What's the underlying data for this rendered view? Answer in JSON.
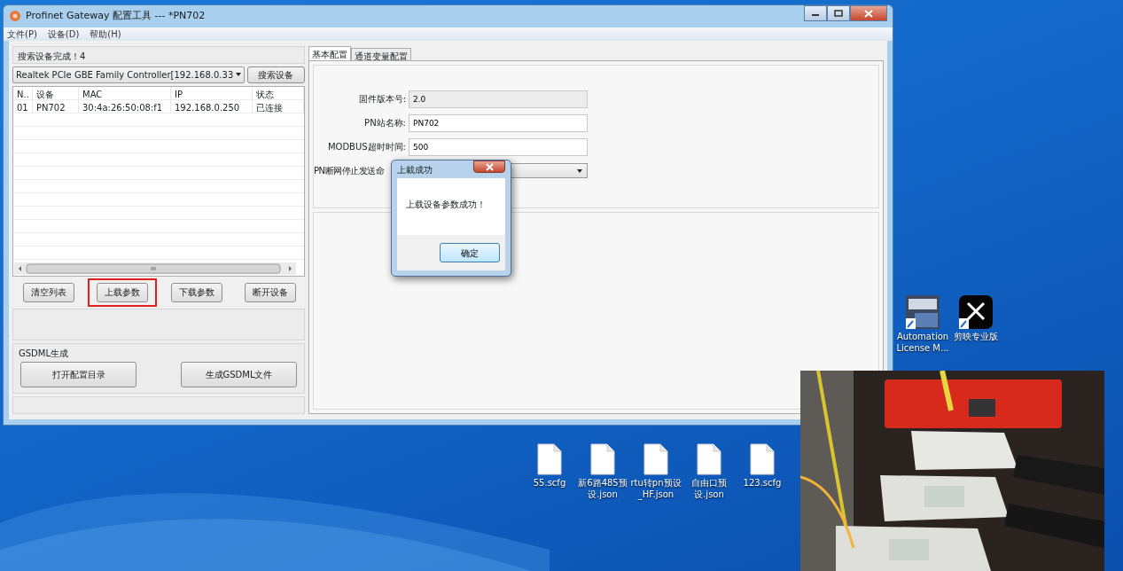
{
  "window": {
    "title": "Profinet Gateway 配置工具 --- *PN702",
    "menu": [
      "文件(P)",
      "设备(D)",
      "帮助(H)"
    ]
  },
  "device_panel": {
    "status": "搜索设备完成！4",
    "adapter": "Realtek PCIe GBE Family Controller[192.168.0.33",
    "search_button": "搜索设备",
    "table": {
      "columns": [
        "N..",
        "设备",
        "MAC",
        "IP",
        "状态"
      ],
      "rows": [
        [
          "01",
          "PN702",
          "30:4a:26:50:08:f1",
          "192.168.0.250",
          "已连接"
        ]
      ]
    },
    "buttons": [
      {
        "label": "清空列表",
        "highlighted": false
      },
      {
        "label": "上载参数",
        "highlighted": true
      },
      {
        "label": "下载参数",
        "highlighted": false
      },
      {
        "label": "断开设备",
        "highlighted": false
      }
    ],
    "gsdml": {
      "title": "GSDML生成",
      "buttons": [
        "打开配置目录",
        "生成GSDML文件"
      ]
    }
  },
  "config_panel": {
    "tabs": [
      {
        "label": "基本配置",
        "selected": true
      },
      {
        "label": "通道变量配置",
        "selected": false
      }
    ],
    "fields": [
      {
        "kind": "readonly",
        "label": "固件版本号:",
        "value": "2.0"
      },
      {
        "kind": "input",
        "label": "PN站名称:",
        "value": "PN702"
      },
      {
        "kind": "input",
        "label": "MODBUS超时时间:",
        "value": "500"
      },
      {
        "kind": "select",
        "label": "PN断网停止发送命"
      }
    ]
  },
  "dialog": {
    "title": "上載成功",
    "message": "上载设备参数成功！",
    "ok_button": "确定"
  },
  "desktop": {
    "shortcuts": [
      {
        "kind": "license",
        "label": "Automation License M..."
      },
      {
        "kind": "editor",
        "label": "剪映专业版"
      }
    ],
    "files": [
      {
        "label": "55.scfg"
      },
      {
        "label": "新6路485预设.json"
      },
      {
        "label": "rtu转pn预设_HF.json"
      },
      {
        "label": "自由口预设.json"
      },
      {
        "label": "123.scfg"
      }
    ]
  }
}
